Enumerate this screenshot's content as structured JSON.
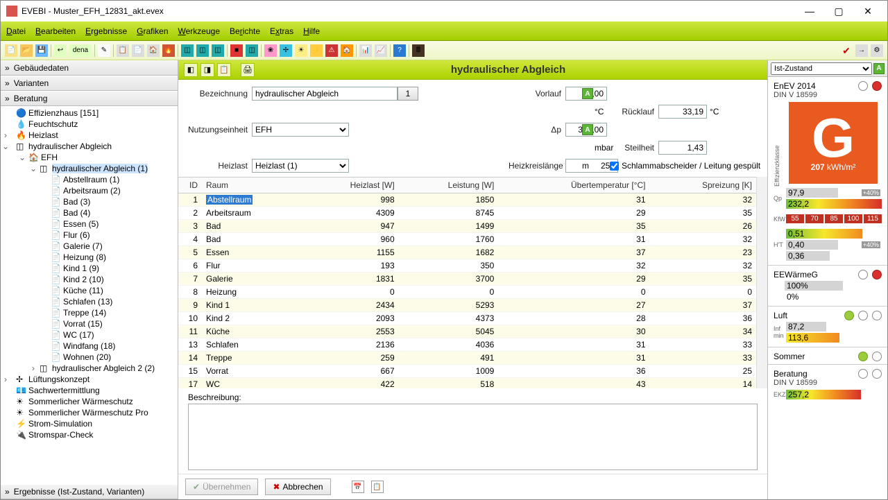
{
  "window": {
    "title": "EVEBI - Muster_EFH_12831_akt.evex"
  },
  "menu": [
    "Datei",
    "Bearbeiten",
    "Ergebnisse",
    "Grafiken",
    "Werkzeuge",
    "Berichte",
    "Extras",
    "Hilfe"
  ],
  "left": {
    "sections": {
      "geb": "Gebäudedaten",
      "var": "Varianten",
      "ber": "Beratung",
      "erg": "Ergebnisse (Ist-Zustand, Varianten)"
    },
    "treeTop": [
      {
        "lbl": "Effizienzhaus [151]",
        "d": 1,
        "icon": "kfw"
      },
      {
        "lbl": "Feuchtschutz",
        "d": 1,
        "icon": "drop"
      },
      {
        "lbl": "Heizlast",
        "d": 1,
        "icon": "heat",
        "tw": ">"
      },
      {
        "lbl": "hydraulischer Abgleich",
        "d": 1,
        "icon": "hyd",
        "tw": "v"
      },
      {
        "lbl": "EFH",
        "d": 2,
        "icon": "house",
        "tw": "v"
      },
      {
        "lbl": "hydraulischer Abgleich (1)",
        "d": 3,
        "icon": "hyd",
        "tw": "v",
        "sel": true
      }
    ],
    "rooms": [
      "Abstellraum (1)",
      "Arbeitsraum (2)",
      "Bad (3)",
      "Bad (4)",
      "Essen (5)",
      "Flur (6)",
      "Galerie (7)",
      "Heizung (8)",
      "Kind 1 (9)",
      "Kind 2 (10)",
      "Küche (11)",
      "Schlafen (13)",
      "Treppe (14)",
      "Vorrat (15)",
      "WC (17)",
      "Windfang (18)",
      "Wohnen (20)"
    ],
    "treeBottom": [
      {
        "lbl": "hydraulischer Abgleich 2 (2)",
        "d": 3,
        "icon": "hyd",
        "tw": ">"
      },
      {
        "lbl": "Lüftungskonzept",
        "d": 1,
        "icon": "fan",
        "tw": ">"
      },
      {
        "lbl": "Sachwertermittlung",
        "d": 1,
        "icon": "euro"
      },
      {
        "lbl": "Sommerlicher Wärmeschutz",
        "d": 1,
        "icon": "sun"
      },
      {
        "lbl": "Sommerlicher Wärmeschutz Pro",
        "d": 1,
        "icon": "sun"
      },
      {
        "lbl": "Strom-Simulation",
        "d": 1,
        "icon": "bolt"
      },
      {
        "lbl": "Stromspar-Check",
        "d": 1,
        "icon": "plug"
      }
    ]
  },
  "center": {
    "title": "hydraulischer Abgleich",
    "labels": {
      "bez": "Bezeichnung",
      "nutz": "Nutzungseinheit",
      "heizlast": "Heizlast",
      "vorlauf": "Vorlauf",
      "dp": "Δp",
      "hkl": "Heizkreislänge",
      "ruecklauf": "Rücklauf",
      "steilheit": "Steilheit",
      "schlamm": "Schlammabscheider / Leitung gespült",
      "beschr": "Beschreibung:"
    },
    "values": {
      "bez": "hydraulischer Abgleich",
      "nutz": "EFH",
      "heizlast": "Heizlast (1)",
      "vorlauf": "70,00",
      "dp": "375,00",
      "hkl": "250",
      "ruecklauf": "33,19",
      "steilheit": "1,43",
      "idx": "1"
    },
    "units": {
      "vorlauf": "°C",
      "dp": "mbar",
      "hkl": "m",
      "ruecklauf": "°C"
    },
    "tableHead": [
      "ID",
      "Raum",
      "Heizlast [W]",
      "Leistung [W]",
      "Übertemperatur [°C]",
      "Spreizung [K]"
    ],
    "tableRows": [
      [
        1,
        "Abstellraum",
        998,
        1850,
        31,
        32
      ],
      [
        2,
        "Arbeitsraum",
        4309,
        8745,
        29,
        35
      ],
      [
        3,
        "Bad",
        947,
        1499,
        35,
        26
      ],
      [
        4,
        "Bad",
        960,
        1760,
        31,
        32
      ],
      [
        5,
        "Essen",
        1155,
        1682,
        37,
        23
      ],
      [
        6,
        "Flur",
        193,
        350,
        32,
        32
      ],
      [
        7,
        "Galerie",
        1831,
        3700,
        29,
        35
      ],
      [
        8,
        "Heizung",
        0,
        0,
        0,
        0
      ],
      [
        9,
        "Kind 1",
        2434,
        5293,
        27,
        37
      ],
      [
        10,
        "Kind 2",
        2093,
        4373,
        28,
        36
      ],
      [
        11,
        "Küche",
        2553,
        5045,
        30,
        34
      ],
      [
        13,
        "Schlafen",
        2136,
        4036,
        31,
        33
      ],
      [
        14,
        "Treppe",
        259,
        491,
        31,
        33
      ],
      [
        15,
        "Vorrat",
        667,
        1009,
        36,
        25
      ],
      [
        17,
        "WC",
        422,
        518,
        43,
        14
      ]
    ],
    "buttons": {
      "ueb": "Übernehmen",
      "abb": "Abbrechen"
    }
  },
  "right": {
    "variant": "Ist-Zustand",
    "enev": {
      "title": "EnEV 2014",
      "sub": "DIN V 18599",
      "klass": "G",
      "kwh": "207",
      "unit": "kWh/m²"
    },
    "qp": {
      "a": "97,9",
      "b": "232,2",
      "pct": "+40%"
    },
    "kw": [
      "55",
      "70",
      "85",
      "100",
      "115"
    ],
    "ht": {
      "a": "0,51",
      "b": "0,40",
      "c": "0,36",
      "pct": "+40%"
    },
    "eewg": {
      "title": "EEWärmeG",
      "a": "100%",
      "b": "0%"
    },
    "luft": {
      "title": "Luft",
      "a": "87,2",
      "b": "113,6"
    },
    "sommer": {
      "title": "Sommer"
    },
    "beratung": {
      "title": "Beratung",
      "sub": "DIN V 18599",
      "v": "257,2"
    }
  }
}
